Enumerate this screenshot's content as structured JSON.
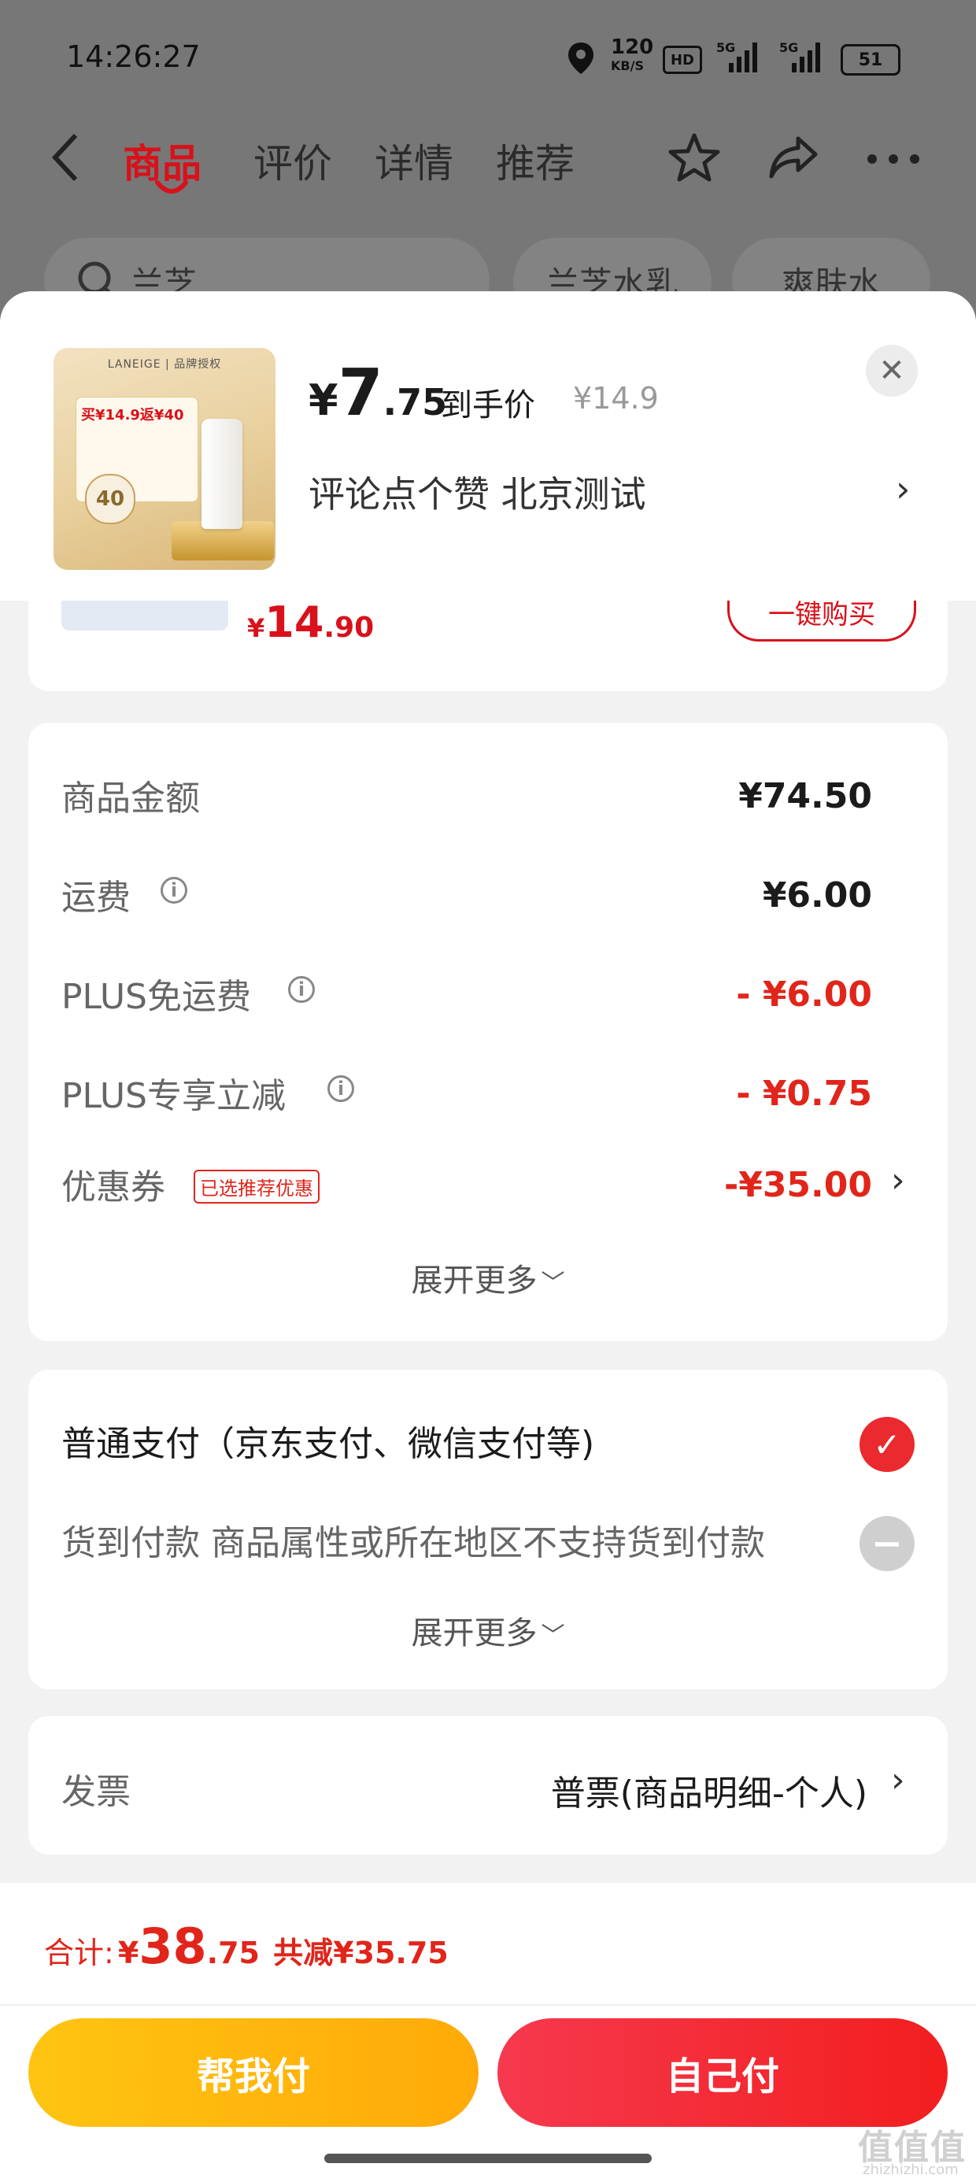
{
  "status_bar": {
    "time": "14:26:27",
    "net_speed_value": "120",
    "net_speed_unit": "KB/S",
    "hd_label": "HD",
    "sig1_label": "5G",
    "sig2_label": "5G",
    "battery": "51"
  },
  "nav": {
    "tabs": [
      {
        "label": "商品",
        "active": true
      },
      {
        "label": "评价"
      },
      {
        "label": "详情"
      },
      {
        "label": "推荐"
      }
    ]
  },
  "bg_chips": [
    "兰芝",
    "兰芝水乳",
    "爽肤水"
  ],
  "product": {
    "price_yen": "¥",
    "price_int": "7",
    "price_dec": ".75",
    "price_label": "到手价",
    "original_price": "¥14.9",
    "spec": "评论点个赞  北京测试",
    "image": {
      "brand_text": "LANEIGE | 品牌授权",
      "promo_text": "买¥14.9返¥40",
      "coupon_value": "40"
    }
  },
  "peek_item": {
    "price_yen": "¥",
    "price_int": "14",
    "price_dec": ".90",
    "buy_button": "一键购买"
  },
  "costs": {
    "rows": [
      {
        "label": "商品金额",
        "value": "¥74.50"
      },
      {
        "label": "运费",
        "value": "¥6.00"
      },
      {
        "label": "PLUS免运费",
        "value": "- ¥6.00"
      },
      {
        "label": "PLUS专享立减",
        "value": "- ¥0.75"
      },
      {
        "label": "优惠券",
        "value": "-¥35.00",
        "badge": "已选推荐优惠"
      }
    ],
    "expand_label": "展开更多"
  },
  "payment": {
    "options": [
      {
        "label": "普通支付（京东支付、微信支付等)",
        "selected": true
      },
      {
        "label": "货到付款 商品属性或所在地区不支持货到付款",
        "selected": false
      }
    ],
    "expand_label": "展开更多"
  },
  "invoice": {
    "label": "发票",
    "value": "普票(商品明细-个人)"
  },
  "footer": {
    "total_label": "合计:",
    "total_yen": "¥",
    "total_int": "38",
    "total_dec": ".75",
    "discount": "共减¥35.75",
    "help_pay": "帮我付",
    "self_pay": "自己付"
  },
  "watermark": {
    "main": "值值值",
    "sub": "zhizhizhi.com"
  },
  "colors": {
    "accent_red": "#e1251b",
    "help_yellow": "#ffb80c",
    "self_red": "#f2293a"
  },
  "icons": {
    "back": "chevron-left-icon",
    "favorite": "star-icon",
    "share": "share-icon",
    "more": "more-dots-icon",
    "search": "search-icon",
    "close": "close-icon",
    "location": "location-pin-icon"
  }
}
